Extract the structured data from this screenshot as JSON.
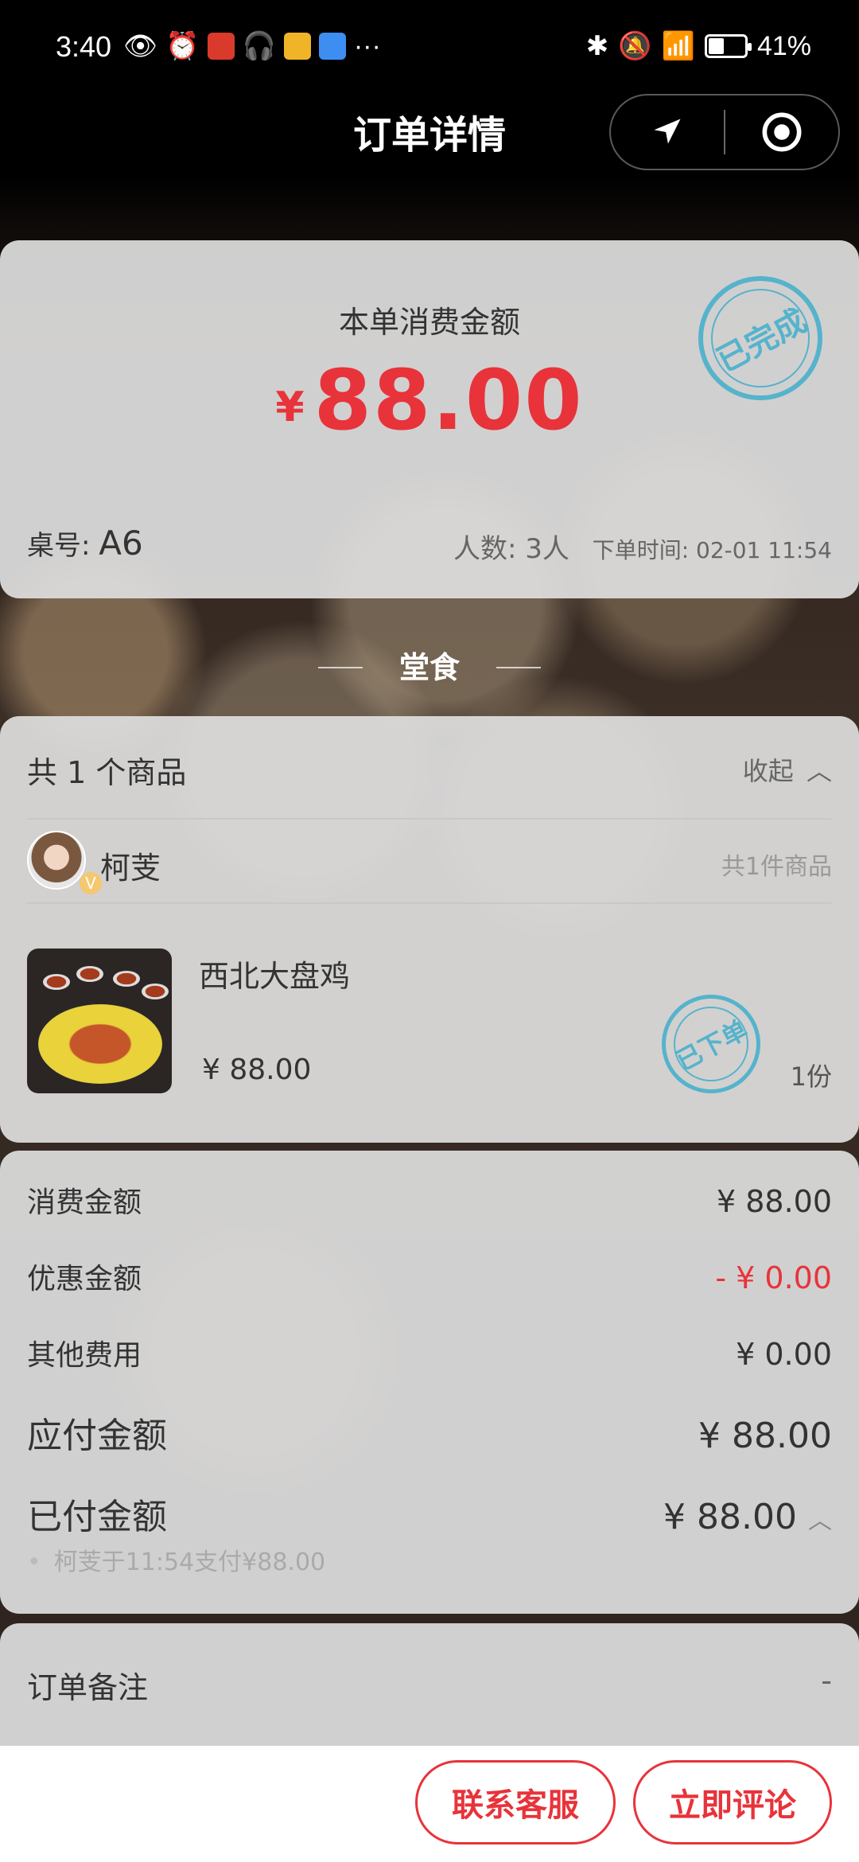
{
  "status_bar": {
    "time": "3:40",
    "battery": "41%"
  },
  "header": {
    "title": "订单详情"
  },
  "summary": {
    "label": "本单消费金额",
    "currency": "¥",
    "amount": "88.00",
    "stamp": "已完成",
    "table_label": "桌号:",
    "table_value": "A6",
    "people": "人数: 3人",
    "order_time": "下单时间: 02-01 11:54"
  },
  "dine_type": "堂食",
  "goods": {
    "count_text": "共 1 个商品",
    "collapse_text": "收起",
    "user_name": "柯芰",
    "vip_badge": "V",
    "user_items": "共1件商品",
    "item": {
      "name": "西北大盘鸡",
      "price": "¥ 88.00",
      "qty": "1份",
      "stamp": "已下单"
    }
  },
  "costs": {
    "consume_label": "消费金额",
    "consume_value": "¥ 88.00",
    "discount_label": "优惠金额",
    "discount_value": "- ¥ 0.00",
    "other_label": "其他费用",
    "other_value": "¥ 0.00",
    "payable_label": "应付金额",
    "payable_value": "¥ 88.00",
    "paid_label": "已付金额",
    "paid_value": "¥ 88.00",
    "pay_record": "柯芰于11:54支付¥88.00"
  },
  "remark": {
    "label": "订单备注",
    "value": "-"
  },
  "actions": {
    "service": "联系客服",
    "review": "立即评论"
  },
  "colors": {
    "accent": "#e8333a",
    "stamp": "#55b3cc"
  }
}
